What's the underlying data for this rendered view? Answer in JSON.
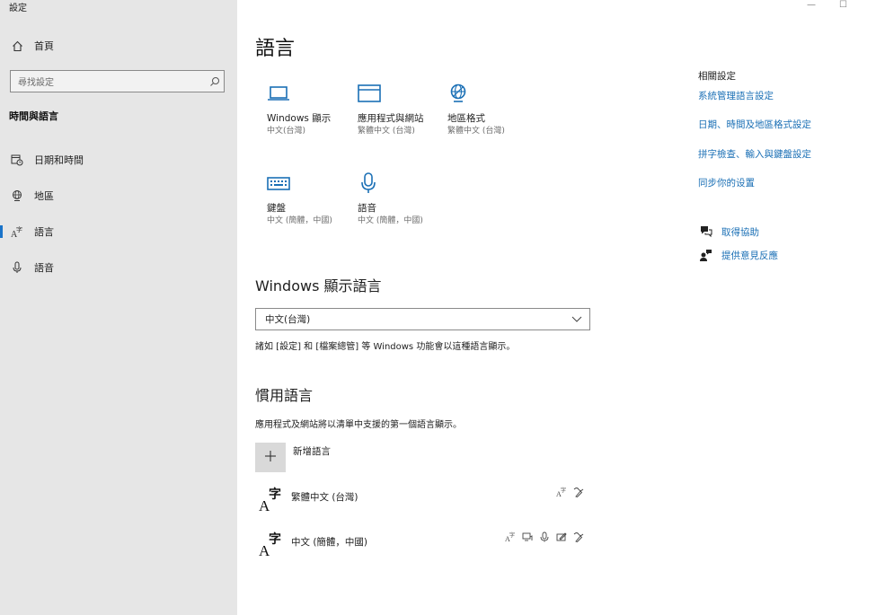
{
  "window": {
    "title": "設定",
    "minimize": "—",
    "maximize": "☐"
  },
  "sidebar": {
    "home_label": "首頁",
    "search_placeholder": "尋找設定",
    "section_title": "時間與語言",
    "items": [
      {
        "label": "日期和時間",
        "icon": "calendar-clock-icon"
      },
      {
        "label": "地區",
        "icon": "globe-icon"
      },
      {
        "label": "語言",
        "icon": "language-icon",
        "active": true
      },
      {
        "label": "語音",
        "icon": "microphone-icon"
      }
    ]
  },
  "main": {
    "title": "語言",
    "tiles": [
      {
        "name": "Windows 顯示",
        "sub": "中文(台灣)",
        "icon": "laptop-icon"
      },
      {
        "name": "應用程式與網站",
        "sub": "繁體中文 (台灣)",
        "icon": "browser-window-icon"
      },
      {
        "name": "地區格式",
        "sub": "繁體中文 (台灣)",
        "icon": "region-globe-icon"
      },
      {
        "name": "鍵盤",
        "sub": "中文 (簡體，中國)",
        "icon": "keyboard-icon"
      },
      {
        "name": "語音",
        "sub": "中文 (簡體，中國)",
        "icon": "microphone-icon"
      }
    ],
    "display_language": {
      "heading": "Windows 顯示語言",
      "selected": "中文(台灣)",
      "note": "諸如 [設定] 和 [檔案總管] 等 Windows 功能會以這種語言顯示。"
    },
    "preferred": {
      "heading": "慣用語言",
      "note": "應用程式及網站將以清單中支援的第一個語言顯示。",
      "add_label": "新增語言",
      "languages": [
        {
          "name": "繁體中文 (台灣)",
          "glyph_a": "A",
          "glyph_z": "字"
        },
        {
          "name": "中文 (簡體，中國)",
          "glyph_a": "A",
          "glyph_z": "字"
        }
      ]
    }
  },
  "related": {
    "heading": "相關設定",
    "links": [
      "系統管理語言設定",
      "日期、時間及地區格式設定",
      "拼字檢查、輸入與鍵盤設定",
      "同步你的设置"
    ],
    "help": [
      {
        "label": "取得協助",
        "icon": "help-chat-icon"
      },
      {
        "label": "提供意見反應",
        "icon": "feedback-person-icon"
      }
    ]
  },
  "colors": {
    "accent": "#1a73c9",
    "link": "#1a6fb5",
    "sidebar_bg": "#e6e6e6"
  }
}
